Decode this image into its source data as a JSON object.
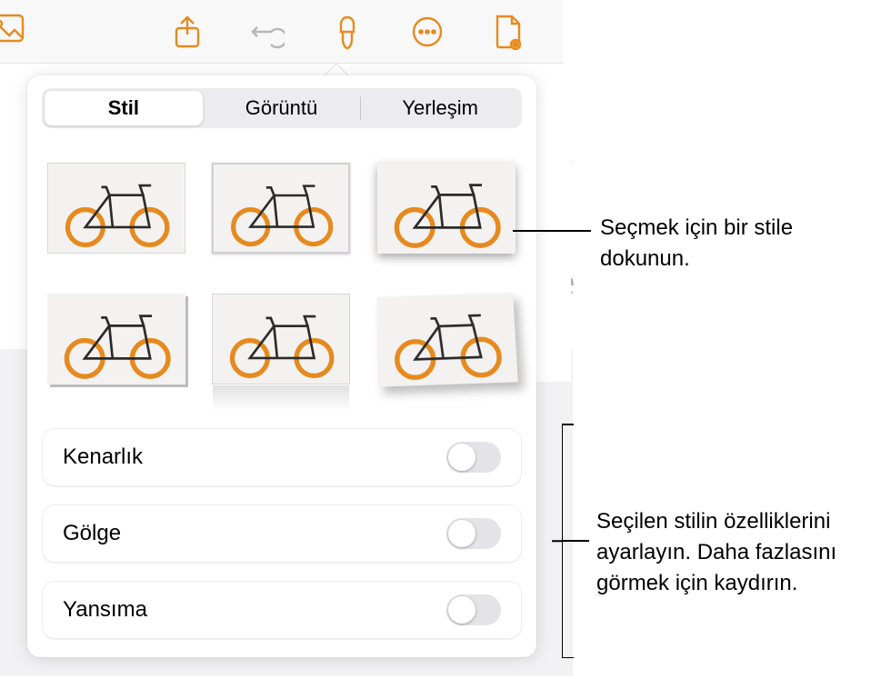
{
  "toolbar": {
    "icons": [
      "media-icon",
      "share-icon",
      "undo-icon",
      "brush-icon",
      "more-icon",
      "document-icon"
    ]
  },
  "popover": {
    "tabs": [
      {
        "label": "Stil",
        "active": true
      },
      {
        "label": "Görüntü",
        "active": false
      },
      {
        "label": "Yerleşim",
        "active": false
      }
    ],
    "thumbnails": [
      {
        "name": "style-plain"
      },
      {
        "name": "style-framed"
      },
      {
        "name": "style-drop-shadow"
      },
      {
        "name": "style-hard-shadow"
      },
      {
        "name": "style-reflection"
      },
      {
        "name": "style-tilt"
      }
    ],
    "options": [
      {
        "label": "Kenarlık",
        "name": "border-toggle",
        "on": false
      },
      {
        "label": "Gölge",
        "name": "shadow-toggle",
        "on": false
      },
      {
        "label": "Yansıma",
        "name": "reflection-toggle",
        "on": false
      }
    ]
  },
  "callouts": {
    "top": "Seçmek için bir stile dokunun.",
    "bottom": "Seçilen stilin özelliklerini ayarlayın. Daha fazlasını görmek için kaydırın."
  },
  "bike_svg_colors": {
    "frame": "#2b2b2b",
    "wheel": "#e68a1f",
    "bg": "#f3f2f1"
  }
}
